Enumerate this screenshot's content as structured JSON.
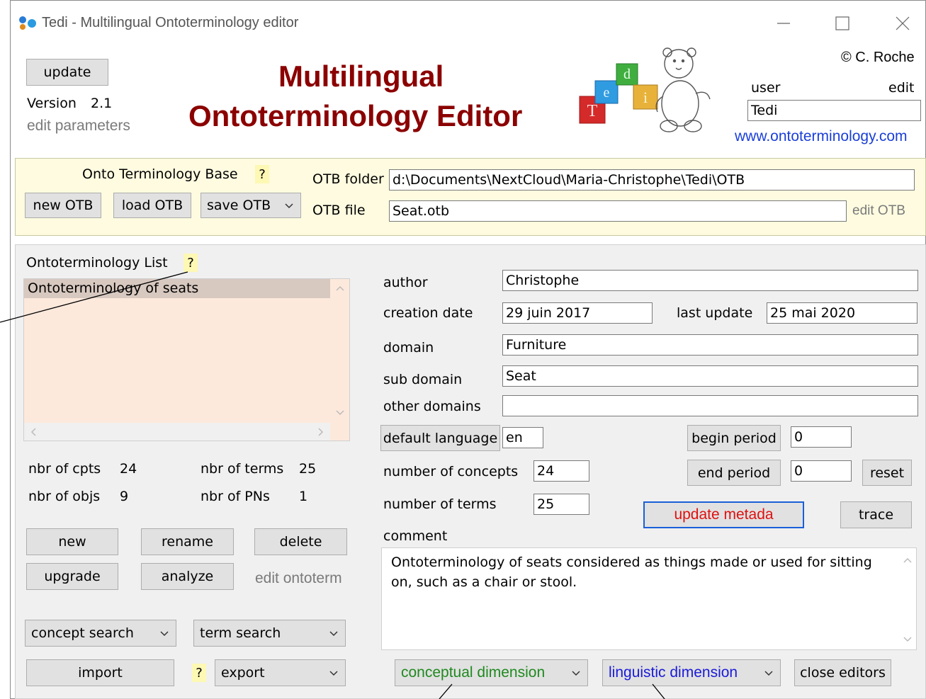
{
  "window": {
    "title": "Tedi - Multilingual Ontoterminology editor",
    "controls": [
      "minimize-icon",
      "maximize-icon",
      "close-icon"
    ]
  },
  "header": {
    "update_label": "update",
    "version_label": "Version",
    "version_value": "2.1",
    "edit_parameters": "edit parameters",
    "title_line1": "Multilingual",
    "title_line2": "Ontoterminology Editor",
    "logo_letters": [
      "T",
      "e",
      "d",
      "i"
    ],
    "copyright": "© C. Roche",
    "user_label": "user",
    "edit_label": "edit",
    "user_value": "Tedi",
    "website": "www.ontoterminology.com",
    "title_color": "#8b0000",
    "link_color": "#1a3fd8"
  },
  "otb": {
    "section_title": "Onto Terminology Base",
    "help": "?",
    "new_label": "new OTB",
    "load_label": "load OTB",
    "save_label": "save OTB",
    "folder_label": "OTB folder",
    "folder_value": "d:\\Documents\\NextCloud\\Maria-Christophe\\Tedi\\OTB",
    "file_label": "OTB file",
    "file_value": "Seat.otb",
    "edit_label": "edit OTB"
  },
  "list": {
    "title": "Ontoterminology List",
    "help": "?",
    "items": [
      "Ontoterminology of seats"
    ],
    "stats": {
      "cpts_label": "nbr of cpts",
      "cpts_value": "24",
      "terms_label": "nbr of terms",
      "terms_value": "25",
      "objs_label": "nbr of objs",
      "objs_value": "9",
      "pns_label": "nbr of PNs",
      "pns_value": "1"
    },
    "new_label": "new",
    "rename_label": "rename",
    "delete_label": "delete",
    "upgrade_label": "upgrade",
    "analyze_label": "analyze",
    "edit_ontoterm": "edit ontoterm",
    "concept_search": "concept search",
    "term_search": "term search",
    "import_label": "import",
    "import_help": "?",
    "export_label": "export"
  },
  "meta": {
    "author_label": "author",
    "author_value": "Christophe",
    "creation_label": "creation date",
    "creation_value": "29 juin 2017",
    "last_update_label": "last update",
    "last_update_value": "25 mai 2020",
    "domain_label": "domain",
    "domain_value": "Furniture",
    "subdomain_label": "sub domain",
    "subdomain_value": "Seat",
    "other_domains_label": "other domains",
    "other_domains_value": "",
    "default_language_label": "default language",
    "default_language_value": "en",
    "begin_period_label": "begin period",
    "begin_period_value": "0",
    "concepts_label": "number of concepts",
    "concepts_value": "24",
    "end_period_label": "end period",
    "end_period_value": "0",
    "reset_label": "reset",
    "terms_label": "number of terms",
    "terms_value": "25",
    "update_metada_label": "update metada",
    "trace_label": "trace",
    "comment_label": "comment",
    "comment_value": "Ontoterminology of seats considered as things made or used for sitting on, such as a chair or stool."
  },
  "footer": {
    "conceptual_dimension": "conceptual dimension",
    "linguistic_dimension": "linguistic dimension",
    "close_editors": "close editors",
    "conceptual_color": "#1f8a1f",
    "linguistic_color": "#1a1adb",
    "update_metada_color": "#e01010"
  }
}
